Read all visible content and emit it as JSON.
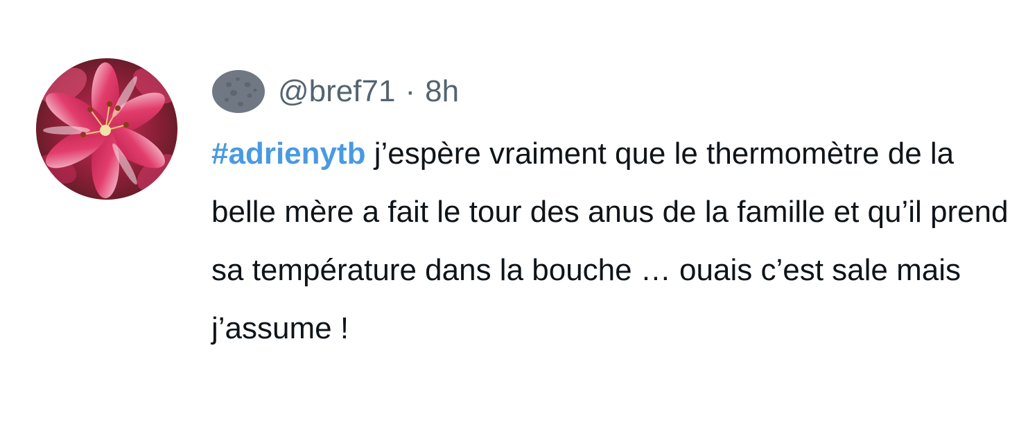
{
  "tweet": {
    "handle": "@bref71",
    "separator": "·",
    "time": "8h",
    "hashtag": "#adrienytb",
    "text": " j’espère vraiment que le thermomètre de la belle mère a fait le tour des anus de la famille et qu’il prend sa température dans la bouche … ouais c’est sale mais j’assume !"
  },
  "icons": {
    "avatar": "lily-flower-avatar",
    "badge": "moon-icon"
  },
  "colors": {
    "hashtag": "#4a9ae1",
    "meta": "#536471",
    "text": "#0f1419",
    "badge": "#6f7883"
  }
}
